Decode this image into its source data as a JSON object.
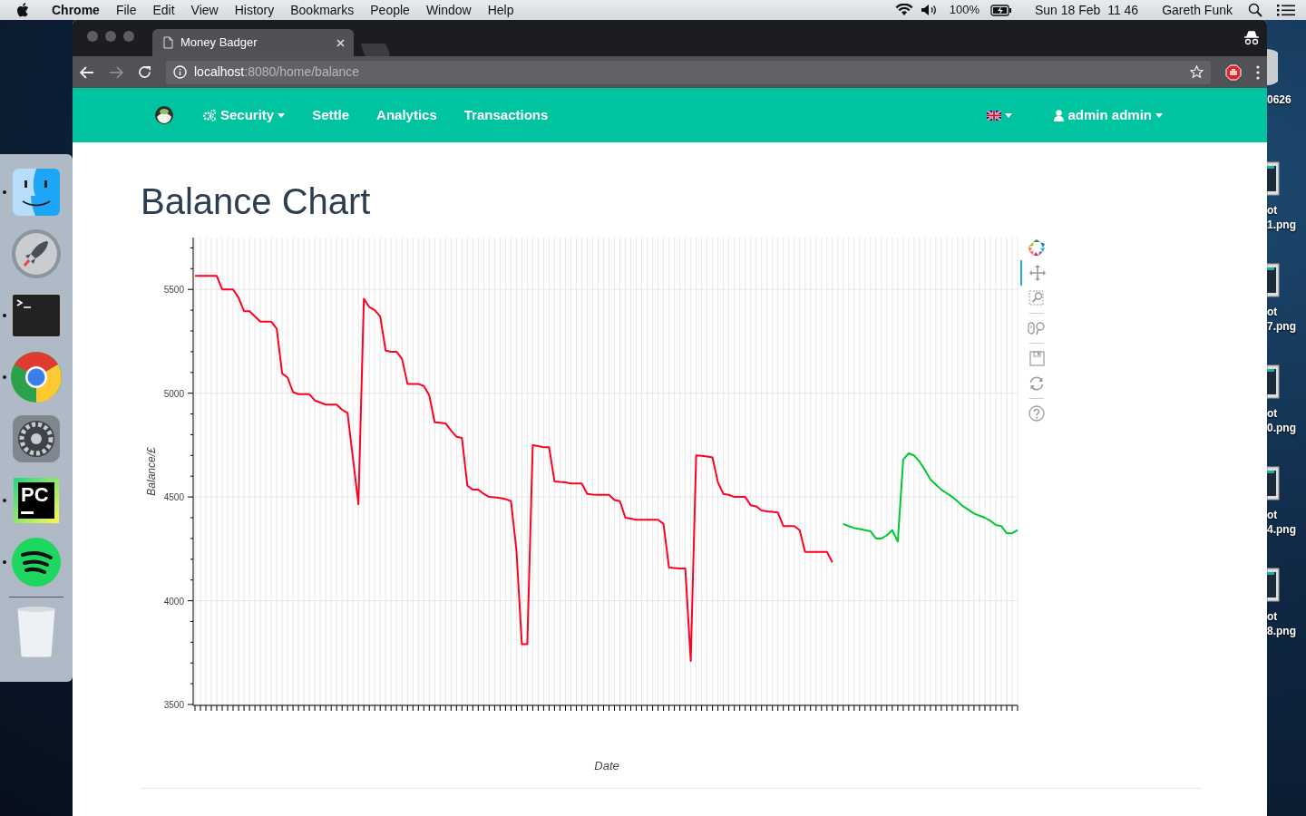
{
  "menubar": {
    "app": "Chrome",
    "menus": [
      "File",
      "Edit",
      "View",
      "History",
      "Bookmarks",
      "People",
      "Window",
      "Help"
    ],
    "battery": "100%",
    "clock": "Sun 18 Feb  11 46",
    "user": "Gareth Funk"
  },
  "dock": {
    "items": [
      {
        "kind": "finder",
        "running": true
      },
      {
        "kind": "launchpad",
        "running": false
      },
      {
        "kind": "terminal",
        "running": true
      },
      {
        "kind": "chrome",
        "running": true
      },
      {
        "kind": "settings",
        "running": false
      },
      {
        "kind": "ide",
        "running": true,
        "label": "PC"
      },
      {
        "kind": "music",
        "running": true
      },
      {
        "kind": "trash",
        "running": false
      }
    ]
  },
  "desktop_icons": [
    {
      "kind": "disc",
      "lines": [
        "0626"
      ]
    },
    {
      "kind": "file",
      "lines": [
        "ot",
        "1.png"
      ]
    },
    {
      "kind": "file",
      "lines": [
        "ot",
        "7.png"
      ]
    },
    {
      "kind": "file",
      "lines": [
        "ot",
        "0.png"
      ]
    },
    {
      "kind": "file",
      "lines": [
        "ot",
        "4.png"
      ]
    },
    {
      "kind": "file",
      "lines": [
        "ot",
        "8.png"
      ]
    }
  ],
  "browser": {
    "tab": {
      "title": "Money Badger"
    },
    "address": {
      "host": "localhost",
      "path": ":8080/home/balance"
    },
    "forward_disabled": true
  },
  "navbar": {
    "items": [
      {
        "label": "Security",
        "kind": "icon_menu",
        "dropdown": true
      },
      {
        "label": "Settle",
        "kind": "link",
        "dropdown": false
      },
      {
        "label": "Analytics",
        "kind": "link",
        "dropdown": false
      },
      {
        "label": "Transactions",
        "kind": "link",
        "dropdown": false
      }
    ],
    "language": {
      "dropdown": true
    },
    "user": {
      "label": "admin admin",
      "dropdown": true
    }
  },
  "page": {
    "title": "Balance Chart",
    "toolbar": [
      {
        "kind": "logo",
        "active": false
      },
      {
        "kind": "pan",
        "active": true
      },
      {
        "kind": "box_zoom",
        "active": false
      },
      {
        "kind": "wheel_zoom",
        "active": false
      },
      {
        "kind": "save",
        "active": false
      },
      {
        "kind": "reset",
        "active": false
      },
      {
        "kind": "help",
        "active": false
      }
    ],
    "chart_data": {
      "type": "line",
      "xlabel": "Date",
      "ylabel": "Balance/£",
      "ylim": [
        3500,
        5750
      ],
      "grid": true,
      "yticks": [
        {
          "value": 3500,
          "label": "3500"
        },
        {
          "value": 4000,
          "label": "4000"
        },
        {
          "value": 4500,
          "label": "4500"
        },
        {
          "value": 5000,
          "label": "5000"
        },
        {
          "value": 5500,
          "label": "5500"
        }
      ],
      "categories": [
        null,
        null,
        null,
        null,
        null,
        null,
        null,
        null,
        null,
        null,
        null,
        null,
        null,
        null,
        null,
        null,
        null,
        null,
        null,
        null,
        null,
        null,
        null,
        null,
        null,
        null,
        null,
        null,
        null,
        null,
        null,
        null,
        null,
        null,
        null,
        null,
        null,
        null,
        null,
        null,
        null,
        null,
        null,
        null,
        null,
        null,
        null,
        null,
        null,
        null,
        null,
        null,
        null,
        null,
        null,
        null,
        null,
        null,
        null,
        null,
        null,
        null,
        null,
        null,
        null,
        null,
        null,
        null,
        null,
        null,
        null,
        null,
        null,
        null,
        null,
        null,
        null,
        null,
        null,
        null,
        null,
        null,
        null,
        null,
        null,
        null,
        null,
        null,
        null,
        null,
        null,
        null,
        null,
        null,
        null,
        null,
        null,
        null,
        null,
        null,
        null,
        null,
        null,
        null,
        null,
        null,
        null,
        null,
        null,
        null,
        null,
        null,
        null,
        null,
        null,
        null,
        null,
        null,
        null,
        null,
        null,
        null,
        null,
        null,
        null,
        null,
        null,
        null,
        null,
        null,
        null,
        null,
        null,
        null,
        null,
        null,
        null,
        null,
        null,
        null,
        null,
        null,
        null,
        null,
        null,
        null,
        null,
        null,
        null,
        null,
        null,
        null
      ],
      "series": [
        {
          "color": "#ff0022",
          "values": [
            5565,
            5565,
            5565,
            5565,
            5565,
            5500,
            5500,
            5500,
            5460,
            5395,
            5395,
            5370,
            5345,
            5345,
            5345,
            5310,
            5095,
            5075,
            5005,
            4995,
            4995,
            4995,
            4965,
            4955,
            4945,
            4945,
            4945,
            4920,
            4905,
            4685,
            4465,
            5455,
            5415,
            5400,
            5370,
            5205,
            5200,
            5200,
            5165,
            5045,
            5045,
            5045,
            5035,
            4990,
            4860,
            4858,
            4855,
            4820,
            4790,
            4785,
            4555,
            4535,
            4535,
            4515,
            4500,
            4498,
            4495,
            4490,
            4480,
            4245,
            3790,
            3790,
            4750,
            4745,
            4740,
            4740,
            4575,
            4572,
            4570,
            4565,
            4565,
            4565,
            4515,
            4512,
            4510,
            4510,
            4510,
            4485,
            4480,
            4400,
            4395,
            4390,
            4390,
            4390,
            4390,
            4390,
            4370,
            4160,
            4158,
            4155,
            4155,
            3710,
            4700,
            4698,
            4695,
            4690,
            4570,
            4515,
            4510,
            4500,
            4500,
            4500,
            4460,
            4455,
            4435,
            4430,
            4428,
            4425,
            4360,
            4360,
            4360,
            4340,
            4235,
            4235,
            4235,
            4235,
            4235,
            4185,
            null,
            null,
            null,
            null,
            null,
            null,
            null,
            null,
            null,
            null,
            null,
            null,
            null,
            null,
            null,
            null,
            null,
            null,
            null,
            null,
            null,
            null,
            null,
            null,
            null,
            null,
            null,
            null,
            null,
            null,
            null,
            null,
            null,
            null
          ]
        },
        {
          "color": "#00c832",
          "values": [
            null,
            null,
            null,
            null,
            null,
            null,
            null,
            null,
            null,
            null,
            null,
            null,
            null,
            null,
            null,
            null,
            null,
            null,
            null,
            null,
            null,
            null,
            null,
            null,
            null,
            null,
            null,
            null,
            null,
            null,
            null,
            null,
            null,
            null,
            null,
            null,
            null,
            null,
            null,
            null,
            null,
            null,
            null,
            null,
            null,
            null,
            null,
            null,
            null,
            null,
            null,
            null,
            null,
            null,
            null,
            null,
            null,
            null,
            null,
            null,
            null,
            null,
            null,
            null,
            null,
            null,
            null,
            null,
            null,
            null,
            null,
            null,
            null,
            null,
            null,
            null,
            null,
            null,
            null,
            null,
            null,
            null,
            null,
            null,
            null,
            null,
            null,
            null,
            null,
            null,
            null,
            null,
            null,
            null,
            null,
            null,
            null,
            null,
            null,
            null,
            null,
            null,
            null,
            null,
            null,
            null,
            null,
            null,
            null,
            null,
            null,
            null,
            null,
            null,
            null,
            null,
            null,
            null,
            null,
            4370,
            4360,
            4350,
            4345,
            4340,
            4335,
            4300,
            4300,
            4315,
            4340,
            4285,
            4680,
            4710,
            4700,
            4670,
            4630,
            4585,
            4560,
            4535,
            4518,
            4500,
            4478,
            4455,
            4438,
            4420,
            4410,
            4400,
            4385,
            4365,
            4360,
            4325,
            4325,
            4340
          ]
        }
      ]
    }
  }
}
